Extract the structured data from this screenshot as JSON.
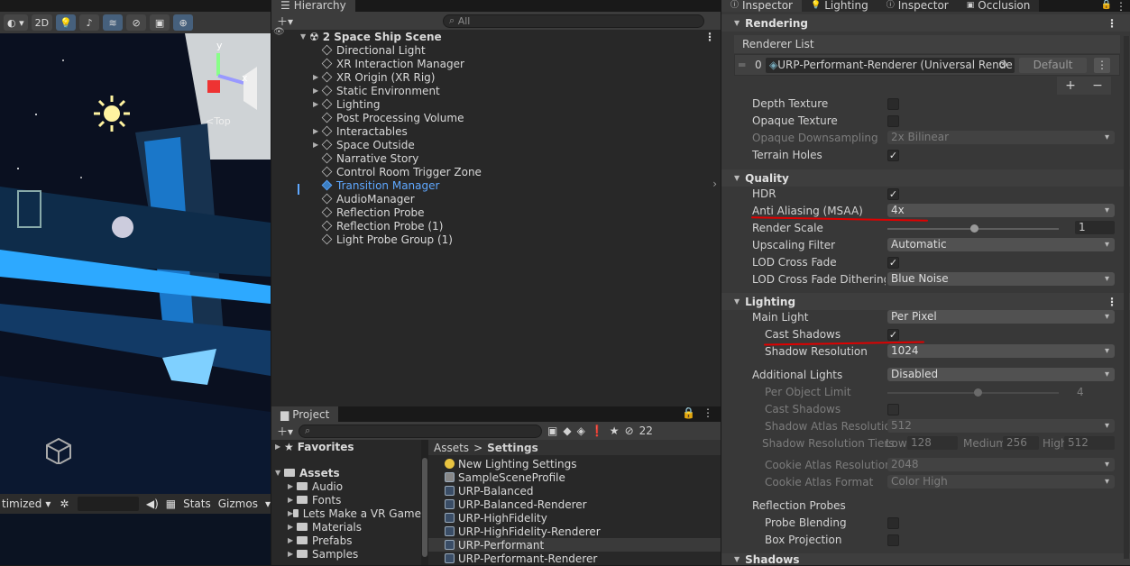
{
  "scene": {
    "toolbar": {
      "mode_2d": "2D"
    },
    "gizmo": {
      "top_label": "<Top",
      "y_axis": "y",
      "x_axis": "x"
    },
    "bottom": {
      "optimized": "timized",
      "stats": "Stats",
      "gizmos": "Gizmos"
    }
  },
  "hierarchy": {
    "tab": "Hierarchy",
    "search_placeholder": "All",
    "scene_name": "2 Space Ship Scene",
    "items": [
      {
        "label": "Directional Light",
        "expandable": false
      },
      {
        "label": "XR Interaction Manager",
        "expandable": false
      },
      {
        "label": "XR Origin (XR Rig)",
        "expandable": true
      },
      {
        "label": "Static Environment",
        "expandable": true
      },
      {
        "label": "Lighting",
        "expandable": true
      },
      {
        "label": "Post Processing Volume",
        "expandable": false
      },
      {
        "label": "Interactables",
        "expandable": true
      },
      {
        "label": "Space Outside",
        "expandable": true
      },
      {
        "label": "Narrative Story",
        "expandable": false
      },
      {
        "label": "Control Room Trigger Zone",
        "expandable": false
      },
      {
        "label": "Transition Manager",
        "expandable": false,
        "highlighted": true
      },
      {
        "label": "AudioManager",
        "expandable": false
      },
      {
        "label": "Reflection Probe",
        "expandable": false
      },
      {
        "label": "Reflection Probe (1)",
        "expandable": false
      },
      {
        "label": "Light Probe Group (1)",
        "expandable": false
      }
    ]
  },
  "project": {
    "tab": "Project",
    "hidden_count": "22",
    "favorites": "Favorites",
    "assets": "Assets",
    "folders": [
      "Audio",
      "Fonts",
      "Lets Make a VR Game",
      "Materials",
      "Prefabs",
      "Samples"
    ],
    "breadcrumb": {
      "root": "Assets",
      "sep": ">",
      "current": "Settings"
    },
    "files": [
      {
        "label": "New Lighting Settings",
        "icon": "lightbulb-icon"
      },
      {
        "label": "SampleSceneProfile",
        "icon": "profile-icon"
      },
      {
        "label": "URP-Balanced",
        "icon": "pipeline-asset-icon"
      },
      {
        "label": "URP-Balanced-Renderer",
        "icon": "pipeline-asset-icon"
      },
      {
        "label": "URP-HighFidelity",
        "icon": "pipeline-asset-icon"
      },
      {
        "label": "URP-HighFidelity-Renderer",
        "icon": "pipeline-asset-icon"
      },
      {
        "label": "URP-Performant",
        "icon": "pipeline-asset-icon",
        "selected": true
      },
      {
        "label": "URP-Performant-Renderer",
        "icon": "pipeline-asset-icon"
      }
    ]
  },
  "inspector": {
    "tabs": [
      "Inspector",
      "Lighting",
      "Inspector",
      "Occlusion"
    ],
    "rendering": {
      "title": "Rendering",
      "renderer_list": "Renderer List",
      "renderer_index": "0",
      "renderer_value": "URP-Performant-Renderer (Universal Rende",
      "default_btn": "Default",
      "plus": "+",
      "minus": "−",
      "depth_texture": "Depth Texture",
      "opaque_texture": "Opaque Texture",
      "opaque_downsampling": "Opaque Downsampling",
      "opaque_downsampling_value": "2x Bilinear",
      "terrain_holes": "Terrain Holes"
    },
    "quality": {
      "title": "Quality",
      "hdr": "HDR",
      "anti_aliasing": "Anti Aliasing (MSAA)",
      "anti_aliasing_value": "4x",
      "render_scale": "Render Scale",
      "render_scale_value": "1",
      "upscaling_filter": "Upscaling Filter",
      "upscaling_filter_value": "Automatic",
      "lod_cross_fade": "LOD Cross Fade",
      "lod_dithering": "LOD Cross Fade Dithering T",
      "lod_dithering_value": "Blue Noise"
    },
    "lighting": {
      "title": "Lighting",
      "main_light": "Main Light",
      "main_light_value": "Per Pixel",
      "cast_shadows": "Cast Shadows",
      "shadow_resolution": "Shadow Resolution",
      "shadow_resolution_value": "1024",
      "additional_lights": "Additional Lights",
      "additional_lights_value": "Disabled",
      "per_object_limit": "Per Object Limit",
      "per_object_limit_value": "4",
      "add_cast_shadows": "Cast Shadows",
      "shadow_atlas_resolution": "Shadow Atlas Resolution",
      "shadow_atlas_resolution_value": "512",
      "shadow_resolution_tiers": "Shadow Resolution Tiers",
      "tier_low": "Low",
      "tier_low_value": "128",
      "tier_medium": "Medium",
      "tier_medium_value": "256",
      "tier_high": "High",
      "tier_high_value": "512",
      "cookie_atlas_resolution": "Cookie Atlas Resolution",
      "cookie_atlas_resolution_value": "2048",
      "cookie_atlas_format": "Cookie Atlas Format",
      "cookie_atlas_format_value": "Color High",
      "reflection_probes": "Reflection Probes",
      "probe_blending": "Probe Blending",
      "box_projection": "Box Projection"
    },
    "shadows": {
      "title": "Shadows"
    }
  },
  "colors": {
    "annotation": "#e00000",
    "highlight_text": "#5fa8ff",
    "selection": "#2c5d87"
  }
}
